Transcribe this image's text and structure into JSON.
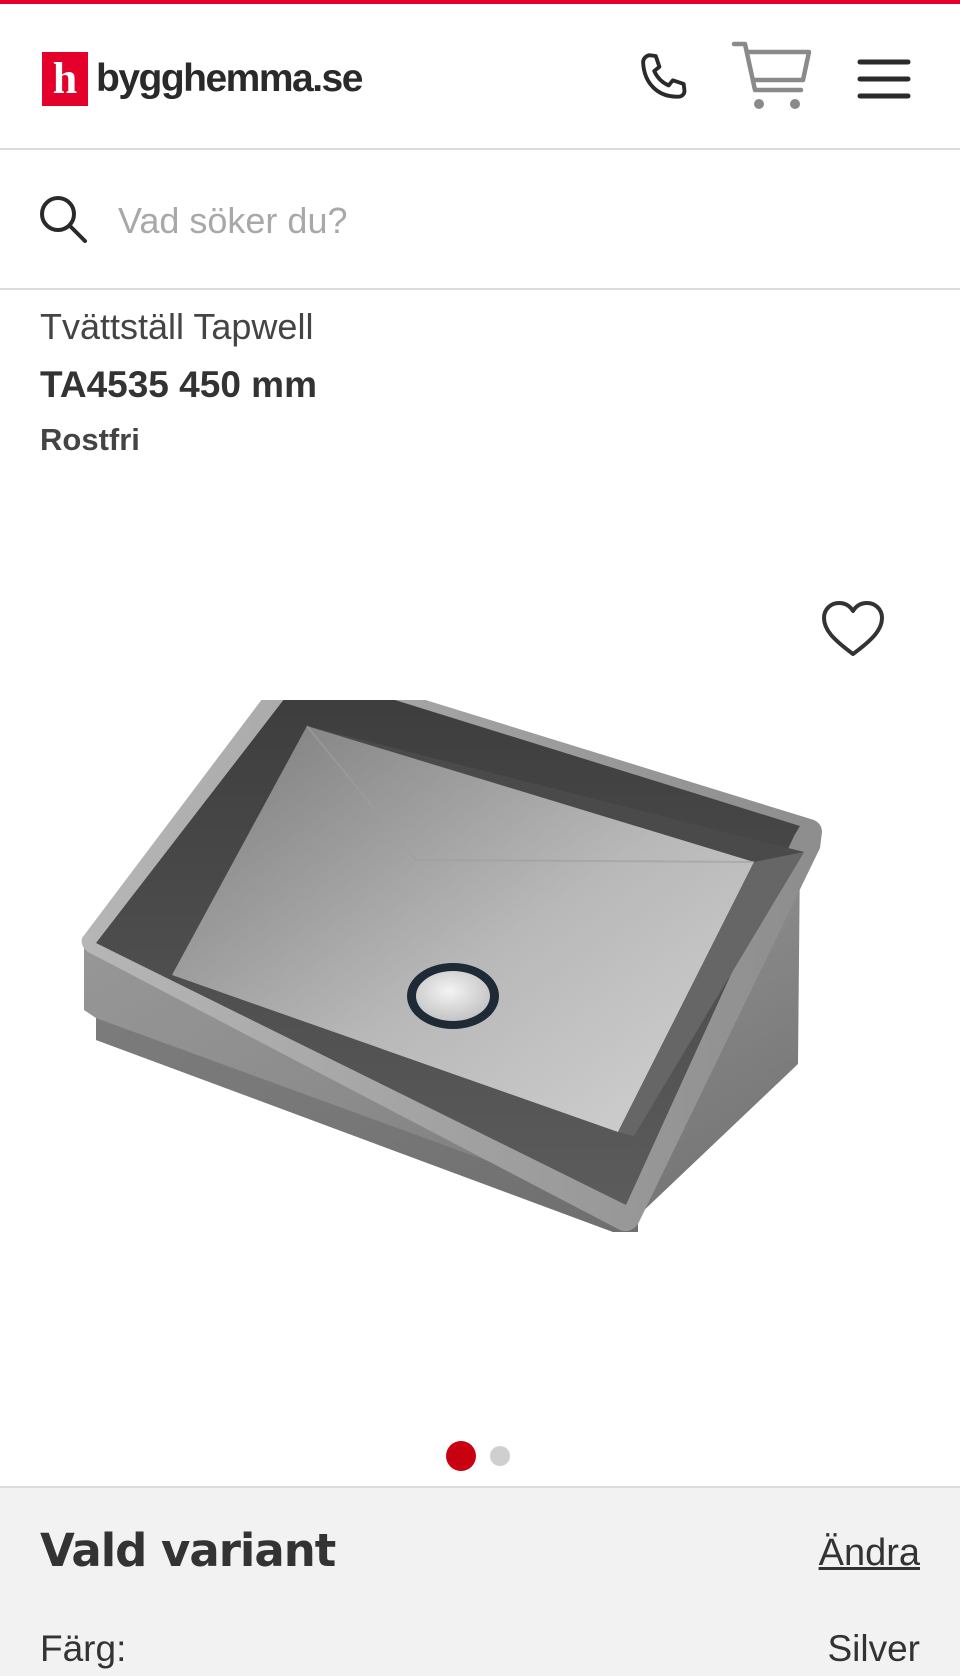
{
  "header": {
    "logo_letter": "h",
    "logo_text": "bygghemma.se",
    "icons": [
      "phone-icon",
      "cart-icon",
      "menu-icon"
    ]
  },
  "search": {
    "placeholder": "Vad söker du?"
  },
  "product": {
    "brand_line": "Tvättställ Tapwell",
    "model_line": "TA4535 450 mm",
    "color_line": "Rostfri",
    "image_slides_total": 2,
    "image_slide_active": 1
  },
  "variant": {
    "title": "Vald variant",
    "change_label": "Ändra",
    "attribute_label": "Färg:",
    "attribute_value": "Silver"
  },
  "colors": {
    "brand_red": "#e4002b",
    "dot_active": "#c8000f",
    "panel_bg": "#f2f2f2"
  }
}
